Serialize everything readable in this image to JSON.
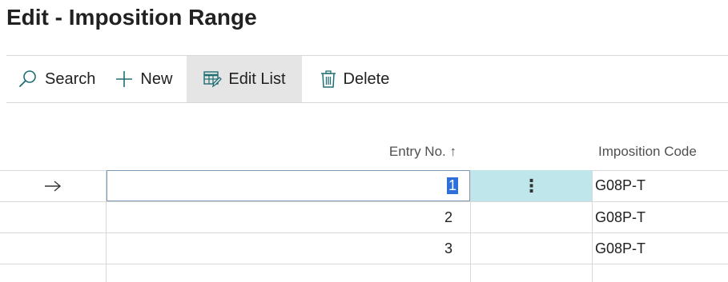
{
  "page": {
    "title": "Edit - Imposition Range"
  },
  "toolbar": {
    "search_label": "Search",
    "new_label": "New",
    "edit_list_label": "Edit List",
    "delete_label": "Delete"
  },
  "table": {
    "columns": {
      "entry_no": "Entry No. ↑",
      "imposition_code": "Imposition Code"
    },
    "rows": [
      {
        "entry_no": "1",
        "imposition_code": "G08P-T",
        "current": true
      },
      {
        "entry_no": "2",
        "imposition_code": "G08P-T",
        "current": false
      },
      {
        "entry_no": "3",
        "imposition_code": "G08P-T",
        "current": false
      }
    ],
    "row_menu_glyph": "⋮",
    "current_row_glyph": "→"
  },
  "colors": {
    "accent_selected_cell": "#bfe6ea",
    "active_button_bg": "#e5e5e5",
    "text_selection": "#2f6fdc",
    "icon_teal": "#1f6e74"
  }
}
